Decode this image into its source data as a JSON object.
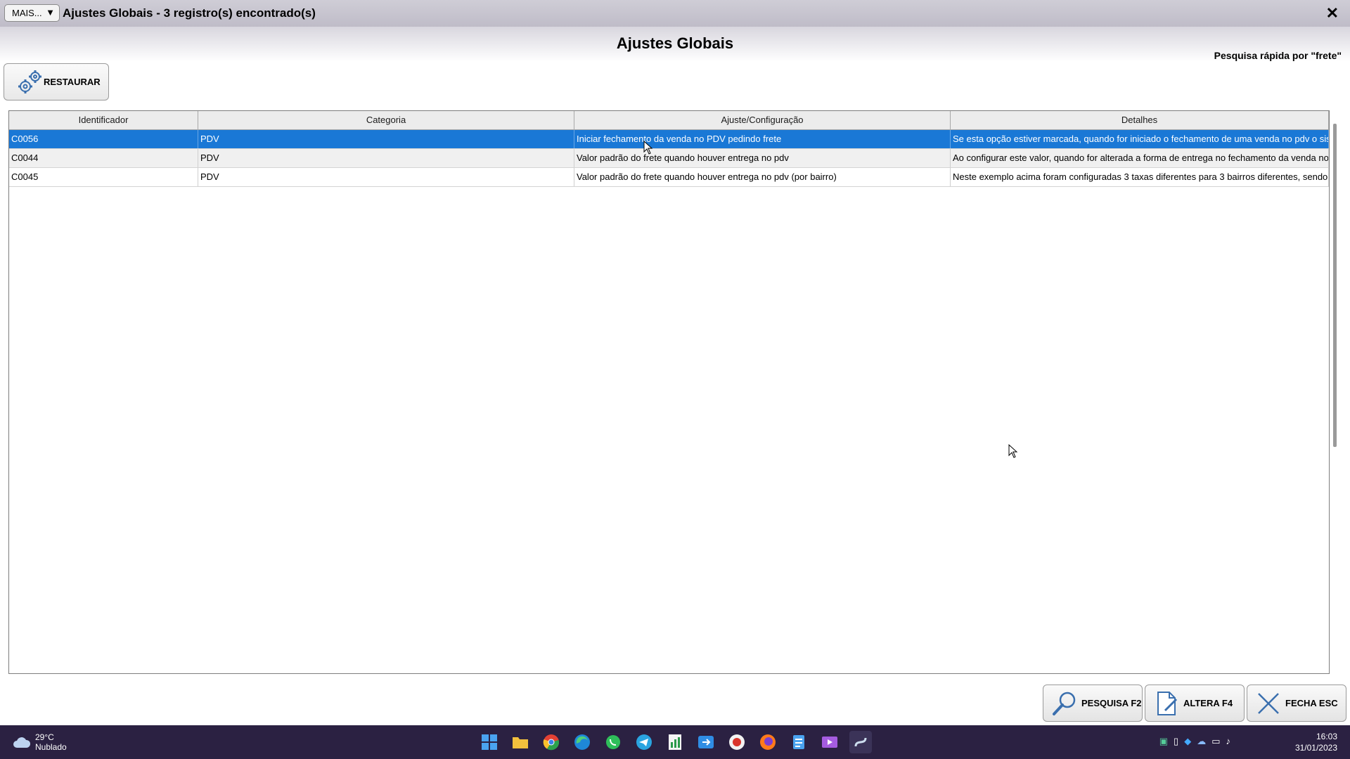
{
  "window": {
    "more_button": "MAIS...",
    "more_arrow": "▼",
    "title": "Ajustes Globais - 3 registro(s) encontrado(s)",
    "close": "✕"
  },
  "page": {
    "heading": "Ajustes Globais",
    "quick_search": "Pesquisa rápida por \"frete\""
  },
  "toolbar": {
    "restore_label": "RESTAURAR"
  },
  "grid": {
    "columns": [
      "Identificador",
      "Categoria",
      "Ajuste/Configuração",
      "Detalhes"
    ],
    "rows": [
      [
        "C0056",
        "PDV",
        "Iniciar fechamento da venda no PDV pedindo frete",
        "Se esta opção estiver marcada, quando for iniciado o fechamento de uma venda no pdv o sis"
      ],
      [
        "C0044",
        "PDV",
        "Valor padrão do frete quando houver entrega no pdv",
        "Ao configurar este valor, quando for alterada a forma de entrega no fechamento da venda no"
      ],
      [
        "C0045",
        "PDV",
        "Valor padrão do frete quando houver entrega no pdv (por bairro)",
        "Neste exemplo acima foram configuradas 3 taxas diferentes para 3 bairros diferentes, sendo"
      ]
    ]
  },
  "actions": {
    "search": "PESQUISA F2",
    "edit": "ALTERA F4",
    "close": "FECHA ESC"
  },
  "taskbar": {
    "weather_temp": "29°C",
    "weather_desc": "Nublado",
    "time": "16:03",
    "date": "31/01/2023"
  },
  "colors": {
    "selected_row": "#1a78d6",
    "taskbar": "#2b2142"
  }
}
